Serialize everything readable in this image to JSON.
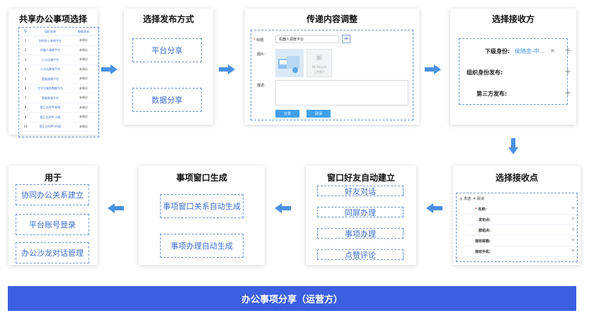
{
  "colors": {
    "accent": "#3b6fd0",
    "arrow": "#4a90e2",
    "banner": "#3b5fe0"
  },
  "card1": {
    "title": "共享办公事项选择",
    "col_headers": [
      "",
      "组织名称",
      "数据状态"
    ],
    "rows": [
      {
        "num": "1",
        "name": "协同办公系统平台",
        "status": "未知分"
      },
      {
        "num": "2",
        "name": "机器人调度平台",
        "status": "未知分"
      },
      {
        "num": "3",
        "name": "小方达域平台",
        "status": "未知分"
      },
      {
        "num": "4",
        "name": "小方达跨域平台",
        "status": "未知分"
      },
      {
        "num": "5",
        "name": "智能建模平台",
        "status": "未知分"
      },
      {
        "num": "6",
        "name": "主平台服务数据平台",
        "status": "未知分"
      },
      {
        "num": "7",
        "name": "智能视频平台",
        "status": "未知分"
      },
      {
        "num": "8",
        "name": "智汇达APP-新版",
        "status": "未知分"
      },
      {
        "num": "9",
        "name": "智汇达APP-小程",
        "status": "未知分"
      },
      {
        "num": "10",
        "name": "智汇达APP-VR版",
        "status": "未知分"
      }
    ]
  },
  "card2": {
    "title": "选择发布方式",
    "opt1": "平台分享",
    "opt2": "数据分享"
  },
  "card3": {
    "title": "传递内容调整",
    "title_label": "标题:",
    "title_value": "机器人调度平台",
    "image_label": "图片:",
    "no_picture": "No Picture",
    "upload_hint": "上传图片",
    "desc_label": "描述:",
    "btn_share": "分享",
    "btn_cancel": "取消"
  },
  "card4": {
    "title": "选择接收方",
    "row1_label": "下级身份:",
    "row1_value": "侯随金-中...",
    "row2_label": "组织身份发布:",
    "row3_label": "第三方发布:"
  },
  "card5": {
    "title": "选择接收点",
    "tool_send": "发送",
    "tool_cancel": "取消",
    "rows": [
      "名称:",
      "发布点:",
      "群组点:",
      "接收邮箱:",
      "接收手机:"
    ]
  },
  "card6": {
    "title": "窗口好友自动建立",
    "items": [
      "好友对话",
      "同屏办理",
      "事项办理",
      "点赞评论"
    ]
  },
  "card7": {
    "title": "事项窗口生成",
    "items": [
      "事项窗口关系自动生成",
      "事项办理自动生成"
    ]
  },
  "card8": {
    "title": "用于",
    "items": [
      "协同办公关系建立",
      "平台账号登录",
      "办公沙龙对话管理"
    ]
  },
  "banner": "办公事项分享（运营方）"
}
